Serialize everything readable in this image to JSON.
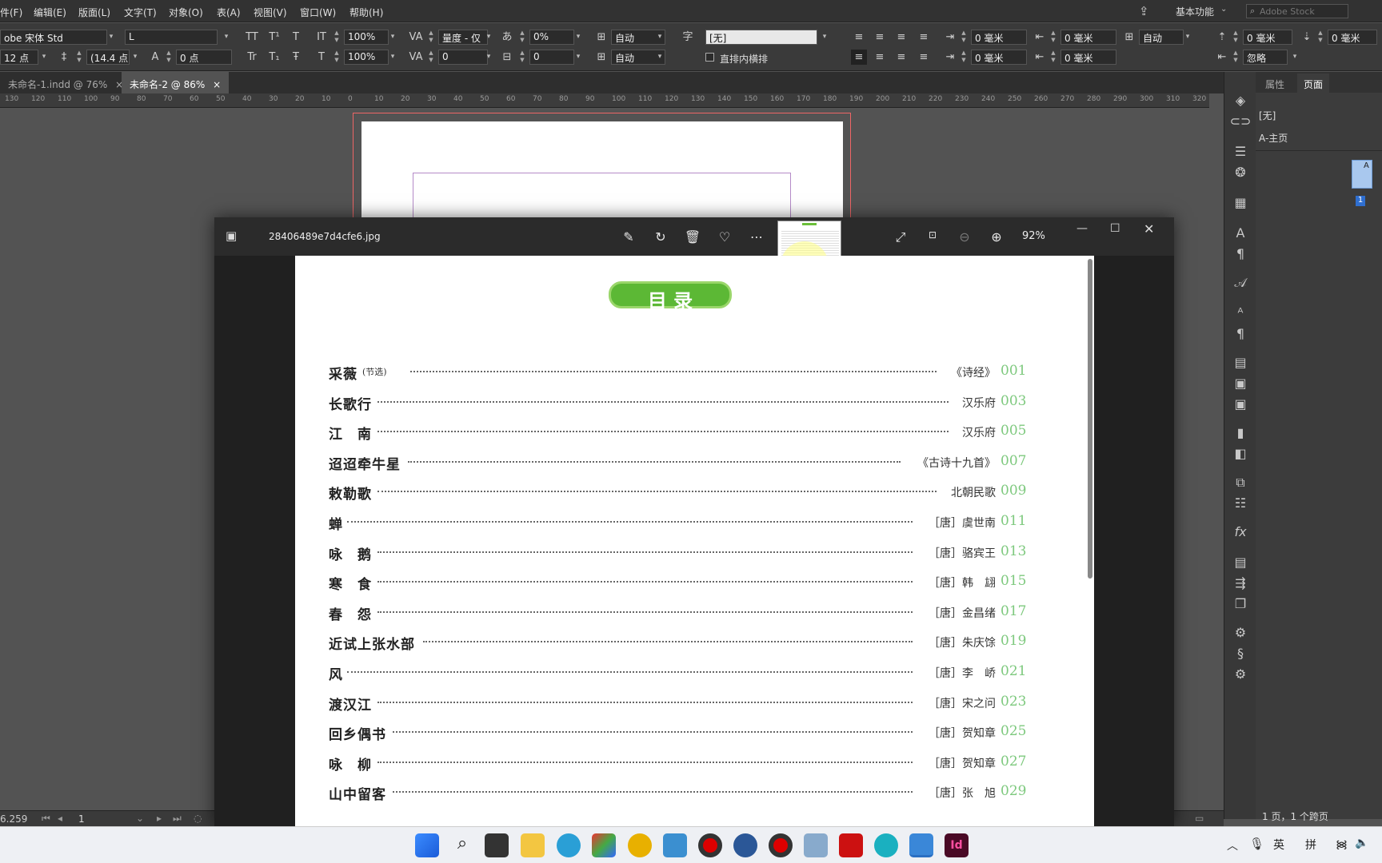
{
  "menu": [
    "件(F)",
    "编辑(E)",
    "版面(L)",
    "文字(T)",
    "对象(O)",
    "表(A)",
    "视图(V)",
    "窗口(W)",
    "帮助(H)"
  ],
  "workspace": "基本功能",
  "search_placeholder": "Adobe Stock",
  "control": {
    "font_family": "obe 宋体 Std",
    "font_style": "L",
    "font_size": "12 点",
    "leading": "(14.4 点",
    "vscale": "100%",
    "hscale": "100%",
    "kerning": "量度 - 仅",
    "tracking": "0",
    "tsume": "0%",
    "baseline": "0 点",
    "skew": "0",
    "mojikumi1": "自动",
    "mojikumi2": "自动",
    "char_style": "[无]",
    "vertical_label": "直排内横排",
    "indent1": "0 毫米",
    "indent2": "0 毫米",
    "indent3": "0 毫米",
    "indent4": "0 毫米",
    "indent5": "0 毫米",
    "indent6": "0 毫米",
    "para_auto": "自动",
    "ignore": "忽略"
  },
  "tabs": [
    {
      "label": "未命名-1.indd @ 76%",
      "close": "×"
    },
    {
      "label": "未命名-2 @ 86%",
      "close": "×"
    }
  ],
  "ruler": [
    "130",
    "120",
    "110",
    "100",
    "90",
    "80",
    "70",
    "60",
    "50",
    "40",
    "30",
    "20",
    "10",
    "0",
    "10",
    "20",
    "30",
    "40",
    "50",
    "60",
    "70",
    "80",
    "90",
    "100",
    "110",
    "120",
    "130",
    "140",
    "150",
    "160",
    "170",
    "180",
    "190",
    "200",
    "210",
    "220",
    "230",
    "240",
    "250",
    "260",
    "270",
    "280",
    "290",
    "300",
    "310",
    "320"
  ],
  "panel": {
    "tab_properties": "属性",
    "tab_pages": "页面",
    "none": "[无]",
    "master": "A-主页",
    "page_label": "A",
    "page_number": "1",
    "footer": "1 页，1 个跨页"
  },
  "status": {
    "zoom": "6.259",
    "page": "1"
  },
  "viewer": {
    "filename": "28406489e7d4cfe6.jpg",
    "zoom": "92%"
  },
  "toc": {
    "heading": "目 录",
    "items": [
      {
        "title": "采薇",
        "note": "(节选)",
        "author": "《诗经》",
        "page": "001"
      },
      {
        "title": "长歌行",
        "note": "",
        "author": "汉乐府",
        "page": "003"
      },
      {
        "title": "江　南",
        "note": "",
        "author": "汉乐府",
        "page": "005"
      },
      {
        "title": "迢迢牵牛星",
        "note": "",
        "author": "《古诗十九首》",
        "page": "007"
      },
      {
        "title": "敕勒歌",
        "note": "",
        "author": "北朝民歌",
        "page": "009"
      },
      {
        "title": "蝉",
        "note": "",
        "author": "［唐］虞世南",
        "page": "011"
      },
      {
        "title": "咏　鹅",
        "note": "",
        "author": "［唐］骆宾王",
        "page": "013"
      },
      {
        "title": "寒　食",
        "note": "",
        "author": "［唐］韩　翃",
        "page": "015"
      },
      {
        "title": "春　怨",
        "note": "",
        "author": "［唐］金昌绪",
        "page": "017"
      },
      {
        "title": "近试上张水部",
        "note": "",
        "author": "［唐］朱庆馀",
        "page": "019"
      },
      {
        "title": "风",
        "note": "",
        "author": "［唐］李　峤",
        "page": "021"
      },
      {
        "title": "渡汉江",
        "note": "",
        "author": "［唐］宋之问",
        "page": "023"
      },
      {
        "title": "回乡偶书",
        "note": "",
        "author": "［唐］贺知章",
        "page": "025"
      },
      {
        "title": "咏　柳",
        "note": "",
        "author": "［唐］贺知章",
        "page": "027"
      },
      {
        "title": "山中留客",
        "note": "",
        "author": "［唐］张　旭",
        "page": "029"
      }
    ]
  },
  "taskbar": {
    "ime1": "英",
    "ime2": "拼"
  }
}
